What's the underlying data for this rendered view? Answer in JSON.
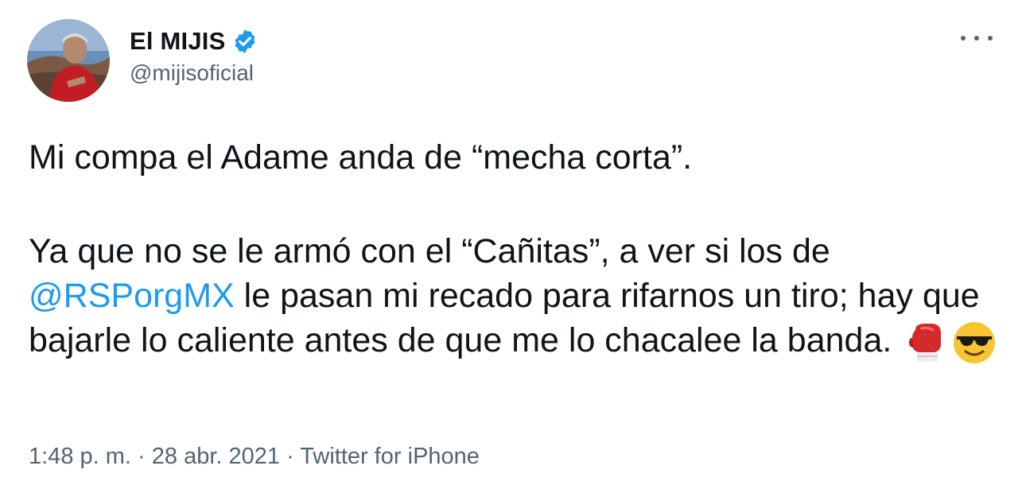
{
  "author": {
    "display_name": "El MIJIS",
    "handle": "@mijisoficial",
    "verified": true,
    "avatar_icon": "profile-photo"
  },
  "more_icon": "more-options-icon",
  "tweet": {
    "line1": "Mi compa el Adame anda de “mecha corta”.",
    "para2_before": "Ya que no se le armó con el “Cañitas”, a ver si los de",
    "mention": "@RSPorgMX",
    "para2_after": " le pasan mi recado para rifarnos un tiro; hay que bajarle lo caliente antes de que me lo chacalee la banda.",
    "emojis": [
      "boxing-glove-icon",
      "sunglasses-face-icon"
    ]
  },
  "meta": {
    "time": "1:48 p. m.",
    "separator": " · ",
    "date": "28 abr. 2021",
    "source": "Twitter for iPhone"
  },
  "colors": {
    "link": "#1d9bf0",
    "secondary_text": "#536471",
    "primary_text": "#0f1419"
  }
}
